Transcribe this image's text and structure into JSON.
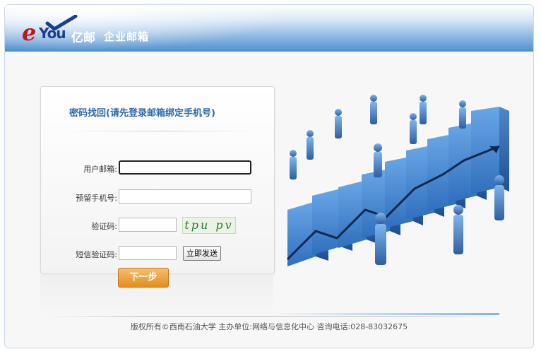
{
  "header": {
    "logo_e": "e",
    "logo_you": "You",
    "logo_cn": "亿邮",
    "subtitle": "企业邮箱"
  },
  "form": {
    "title": "密码找回(请先登录邮箱绑定手机号)",
    "email_label": "用户邮箱:",
    "email_value": "",
    "phone_label": "预留手机号:",
    "phone_value": "",
    "captcha_label": "验证码:",
    "captcha_value": "",
    "captcha_text": "tpu pv",
    "sms_label": "短信验证码:",
    "sms_value": "",
    "sms_button": "立即发送",
    "next_button": "下一步"
  },
  "footer": {
    "text": "版权所有©西南石油大学 主办单位:网络与信息化中心 咨询电话:028-83032675"
  },
  "colors": {
    "header_blue": "#4d8fd0",
    "title_blue": "#2d6aab",
    "button_orange": "#e38d1c",
    "captcha_green": "#2b7a34"
  },
  "icons": [
    "eyou-logo",
    "business-growth-illustration"
  ]
}
